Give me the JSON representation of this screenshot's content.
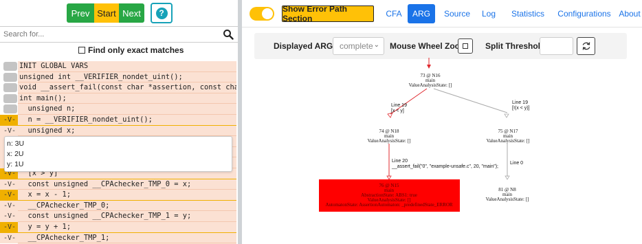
{
  "step_controls": {
    "prev": "Prev",
    "start": "Start",
    "next": "Next",
    "help": "?"
  },
  "search": {
    "placeholder": "Search for..."
  },
  "exact_match_label": "Find only exact matches",
  "code_lines": [
    {
      "gutter": "",
      "text": "INIT GLOBAL VARS"
    },
    {
      "gutter": "",
      "text": "unsigned int __VERIFIER_nondet_uint();"
    },
    {
      "gutter": "",
      "text": "void __assert_fail(const char *assertion, const char *file"
    },
    {
      "gutter": "",
      "text": "int main();"
    },
    {
      "gutter": "",
      "text": "  unsigned n;"
    },
    {
      "gutter": "-V-",
      "text": "  n = __VERIFIER_nondet_uint();"
    },
    {
      "gutter": "-V-",
      "text": "  unsigned x;"
    },
    {
      "gutter": "-V-",
      "text": ""
    },
    {
      "gutter": "-V-",
      "text": ""
    },
    {
      "gutter": "-V-",
      "text": ""
    },
    {
      "gutter": "-V-",
      "text": "  [x > y]"
    },
    {
      "gutter": "-V-",
      "text": "  const unsigned __CPAchecker_TMP_0 = x;"
    },
    {
      "gutter": "-V-",
      "text": "  x = x - 1;"
    },
    {
      "gutter": "-V-",
      "text": "  __CPAchecker_TMP_0;"
    },
    {
      "gutter": "-V-",
      "text": "  const unsigned __CPAchecker_TMP_1 = y;"
    },
    {
      "gutter": "-V-",
      "text": "  y = y + 1;"
    },
    {
      "gutter": "-V-",
      "text": "  __CPAchecker_TMP_1;"
    },
    {
      "gutter": "",
      "text": ""
    }
  ],
  "values_popup": [
    "n: 3U",
    "x: 2U",
    "y: 1U"
  ],
  "nav": {
    "error_path_button": "Show Error Path Section",
    "tabs": [
      "CFA",
      "ARG",
      "Source",
      "Log",
      "Statistics",
      "Configurations",
      "About"
    ],
    "active_tab": "ARG"
  },
  "toolbar": {
    "displayed_arg_label": "Displayed ARG",
    "displayed_arg_value": "complete",
    "zoom_label": "Mouse Wheel Zoom",
    "split_label": "Split Threshold"
  },
  "graph": {
    "nodes": [
      {
        "id": "n16",
        "lines": [
          "73 @ N16",
          "main",
          "ValueAnalysisState: []"
        ]
      },
      {
        "id": "n18",
        "lines": [
          "74 @ N18",
          "main",
          "ValueAnalysisState: []"
        ]
      },
      {
        "id": "n17",
        "lines": [
          "75 @ N17",
          "main",
          "ValueAnalysisState: []"
        ]
      },
      {
        "id": "n15",
        "lines": [
          "76 @ N15",
          "main",
          "AbstractionState: ABS1: true",
          "ValueAnalysisState: []",
          "AutomatonState: AssertionAutomaton: _predefinedState_ERROR"
        ]
      },
      {
        "id": "n8",
        "lines": [
          "81 @ N8",
          "main",
          "ValueAnalysisState: []"
        ]
      }
    ],
    "edges": [
      {
        "id": "e1",
        "lines": [
          "Line 19",
          "[x < y]"
        ]
      },
      {
        "id": "e2",
        "lines": [
          "Line 19",
          "[!(x < y)]"
        ]
      },
      {
        "id": "e3",
        "lines": [
          "Line 20",
          "__assert_fail(\"0\", \"example-unsafe.c\", 20, \"main\");"
        ]
      },
      {
        "id": "e4",
        "lines": [
          "Line 0"
        ]
      }
    ],
    "colors": {
      "error_path": "#e0282e",
      "normal_edge": "#aaaaaa",
      "error_node": "#ff0000"
    }
  }
}
